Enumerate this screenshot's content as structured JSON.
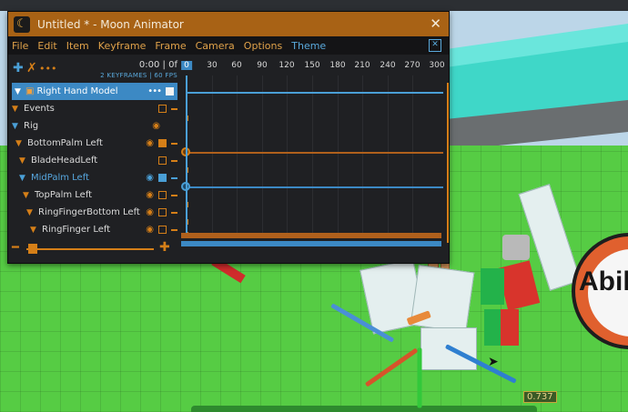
{
  "window": {
    "title": "Untitled * - Moon Animator",
    "close_glyph": "✕",
    "menu": [
      "File",
      "Edit",
      "Item",
      "Keyframe",
      "Frame",
      "Camera",
      "Options",
      "Theme"
    ],
    "menu_close_glyph": "✕"
  },
  "toolbar": {
    "time": "0:00  |  0f",
    "sub": "2 KEYFRAMES  |  60 FPS"
  },
  "tree": {
    "selected_item": "Right Hand Model",
    "rows": [
      {
        "label": "Events"
      },
      {
        "label": "Rig"
      },
      {
        "label": "BottomPalm Left"
      },
      {
        "label": "BladeHeadLeft"
      },
      {
        "label": "MidPalm Left"
      },
      {
        "label": "TopPalm Left"
      },
      {
        "label": "RingFingerBottom Left"
      },
      {
        "label": "RingFinger Left"
      }
    ]
  },
  "timeline": {
    "ticks": [
      "0",
      "30",
      "60",
      "90",
      "120",
      "150",
      "180",
      "210",
      "240",
      "270",
      "300"
    ],
    "current_frame": "0"
  },
  "viewport": {
    "ability_text": "Abil",
    "value_readout": "0.737"
  },
  "colors": {
    "accent_orange": "#d57f18",
    "accent_blue": "#4a9fd6",
    "titlebar": "#a86215"
  }
}
